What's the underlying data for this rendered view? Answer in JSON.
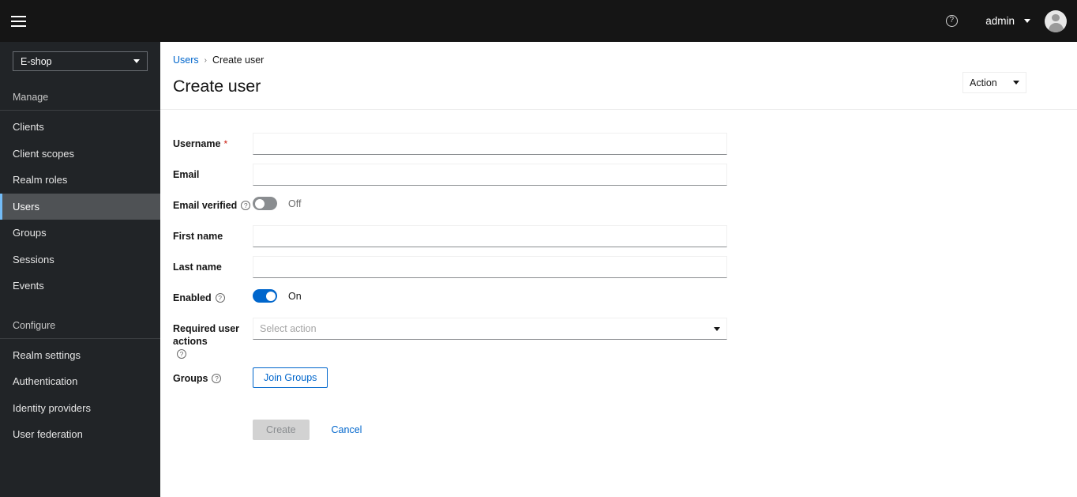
{
  "masthead": {
    "hamburger_icon": "hamburger-menu-icon",
    "help_icon": "question-circle-icon",
    "help_glyph": "?",
    "username": "admin",
    "user_caret_icon": "chevron-down-icon",
    "avatar_icon": "user-avatar-icon"
  },
  "sidebar": {
    "realm": {
      "selected": "E-shop",
      "caret_icon": "chevron-down-icon"
    },
    "sections": [
      {
        "title": "Manage",
        "items": [
          {
            "label": "Clients",
            "selected": false
          },
          {
            "label": "Client scopes",
            "selected": false
          },
          {
            "label": "Realm roles",
            "selected": false
          },
          {
            "label": "Users",
            "selected": true
          },
          {
            "label": "Groups",
            "selected": false
          },
          {
            "label": "Sessions",
            "selected": false
          },
          {
            "label": "Events",
            "selected": false
          }
        ]
      },
      {
        "title": "Configure",
        "items": [
          {
            "label": "Realm settings",
            "selected": false
          },
          {
            "label": "Authentication",
            "selected": false
          },
          {
            "label": "Identity providers",
            "selected": false
          },
          {
            "label": "User federation",
            "selected": false
          }
        ]
      }
    ]
  },
  "page": {
    "breadcrumb": {
      "parent": "Users",
      "separator": "›",
      "current": "Create user"
    },
    "title": "Create user",
    "action_dropdown": {
      "label": "Action",
      "caret_icon": "chevron-down-icon"
    }
  },
  "form": {
    "username": {
      "label": "Username",
      "required_marker": "*",
      "value": "",
      "placeholder": ""
    },
    "email": {
      "label": "Email",
      "value": "",
      "placeholder": ""
    },
    "email_verified": {
      "label": "Email verified",
      "help_glyph": "?",
      "state": "off",
      "state_label": "Off"
    },
    "first_name": {
      "label": "First name",
      "value": "",
      "placeholder": ""
    },
    "last_name": {
      "label": "Last name",
      "value": "",
      "placeholder": ""
    },
    "enabled": {
      "label": "Enabled",
      "help_glyph": "?",
      "state": "on",
      "state_label": "On"
    },
    "required_user_actions": {
      "label": "Required user actions",
      "help_glyph": "?",
      "placeholder": "Select action",
      "caret_icon": "chevron-down-icon"
    },
    "groups": {
      "label": "Groups",
      "help_glyph": "?",
      "join_button": "Join Groups"
    },
    "submit": {
      "create_label": "Create",
      "create_disabled": true,
      "cancel_label": "Cancel"
    }
  },
  "colors": {
    "masthead_bg": "#151515",
    "sidebar_bg": "#212427",
    "sidebar_selected_bg": "#4f5255",
    "accent_blue": "#0066cc",
    "link_blue": "#0066cc",
    "nav_accent_bar": "#73bcf7",
    "required_red": "#c9190b",
    "toggle_off": "#8a8d90",
    "toggle_on": "#0066cc",
    "disabled_btn_bg": "#d2d2d2"
  }
}
